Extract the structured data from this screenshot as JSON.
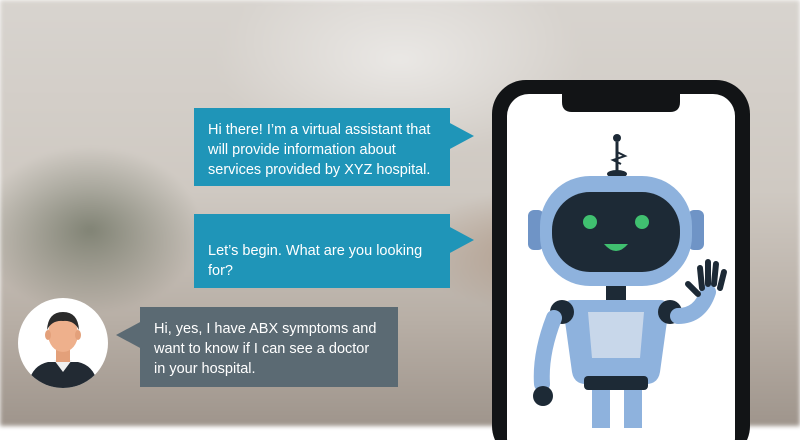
{
  "chat": {
    "messages": [
      {
        "role": "bot",
        "text": "Hi there! I’m a virtual assistant that will provide information about services provided by XYZ hospital."
      },
      {
        "role": "bot",
        "text": "Let’s begin. What are you looking for?"
      },
      {
        "role": "user",
        "text": "Hi, yes, I have ABX symptoms and want to know if I can see a doctor in your hospital."
      }
    ]
  },
  "colors": {
    "bot_bubble": "#1f95b8",
    "user_bubble": "#5b6a73",
    "robot_body": "#8eb2dd",
    "robot_dark": "#1d2a36",
    "robot_accent": "#40c070"
  },
  "icons": [
    "user-avatar",
    "robot-illustration",
    "smartphone"
  ]
}
